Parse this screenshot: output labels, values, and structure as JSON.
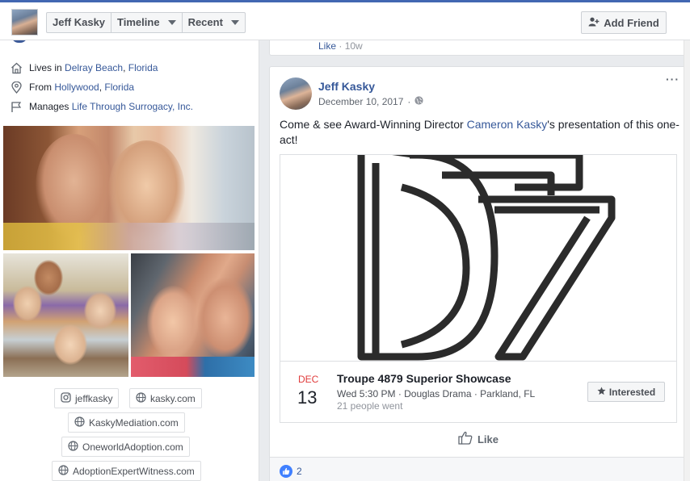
{
  "header": {
    "tabs": [
      {
        "label": "Jeff Kasky",
        "has_caret": false
      },
      {
        "label": "Timeline",
        "has_caret": true
      },
      {
        "label": "Recent",
        "has_caret": true
      }
    ],
    "add_friend_label": "Add Friend"
  },
  "intro": {
    "lives": {
      "prefix": "Lives in ",
      "city": "Delray Beach",
      "sep": ", ",
      "state": "Florida"
    },
    "from": {
      "prefix": "From ",
      "city": "Hollywood",
      "sep": ", ",
      "state": "Florida"
    },
    "manages": {
      "prefix": "Manages ",
      "page": "Life Through Surrogacy, Inc."
    }
  },
  "links": [
    {
      "label": "jeffkasky",
      "icon": "instagram-icon"
    },
    {
      "label": "kasky.com",
      "icon": "globe-icon"
    },
    {
      "label": "KaskyMediation.com",
      "icon": "globe-icon"
    },
    {
      "label": "OneworldAdoption.com",
      "icon": "globe-icon"
    },
    {
      "label": "AdoptionExpertWitness.com",
      "icon": "globe-icon"
    }
  ],
  "previous_post": {
    "like_label": "Like",
    "separator": " · ",
    "time": "10w"
  },
  "post": {
    "author": "Jeff Kasky",
    "date": "December 10, 2017",
    "date_separator": "·",
    "more_label": "···",
    "text_before": "Come & see Award-Winning Director ",
    "mention": "Cameron Kasky",
    "text_after": "'s presentation of this one-act!",
    "event": {
      "month": "DEC",
      "day": "13",
      "title": "Troupe 4879 Superior Showcase",
      "details": "Wed 5:30 PM · Douglas Drama · Parkland, FL",
      "went": "21 people went",
      "interested_label": "Interested"
    },
    "like_label": "Like",
    "reaction_count": "2"
  },
  "colors": {
    "link": "#365899",
    "facebook_blue": "#4267b2",
    "like_blue": "#4080ff",
    "event_month": "#e03b3b"
  }
}
